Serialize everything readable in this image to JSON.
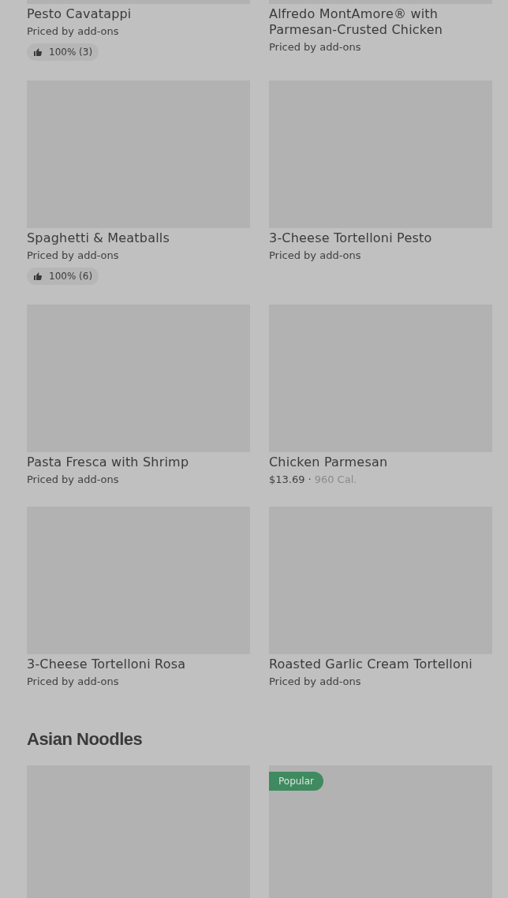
{
  "sections": [
    {
      "items": [
        {
          "kind": "dish",
          "name": "Pesto Cavatappi",
          "price": "Priced by add-ons",
          "rating": "100% (3)"
        },
        {
          "kind": "dish",
          "name": "Alfredo MontAmore® with Parmesan-Crusted Chicken",
          "price": "Priced by add-ons"
        },
        {
          "kind": "dish",
          "name": "Spaghetti & Meatballs",
          "price": "Priced by add-ons",
          "rating": "100% (6)"
        },
        {
          "kind": "dish",
          "name": "3-Cheese Tortelloni Pesto",
          "price": "Priced by add-ons"
        },
        {
          "kind": "dish",
          "name": "Pasta Fresca with Shrimp",
          "price": "Priced by add-ons"
        },
        {
          "kind": "dish",
          "name": "Chicken Parmesan",
          "price": "$13.69",
          "separator": "·",
          "calories": "960 Cal."
        },
        {
          "kind": "dish",
          "name": "3-Cheese Tortelloni Rosa",
          "price": "Priced by add-ons"
        },
        {
          "kind": "dish",
          "name": "Roasted Garlic Cream Tortelloni",
          "price": "Priced by add-ons"
        }
      ]
    },
    {
      "title": "Asian Noodles",
      "items": [
        {
          "kind": "image_only"
        },
        {
          "kind": "image_only",
          "badge": "Popular"
        }
      ]
    }
  ]
}
